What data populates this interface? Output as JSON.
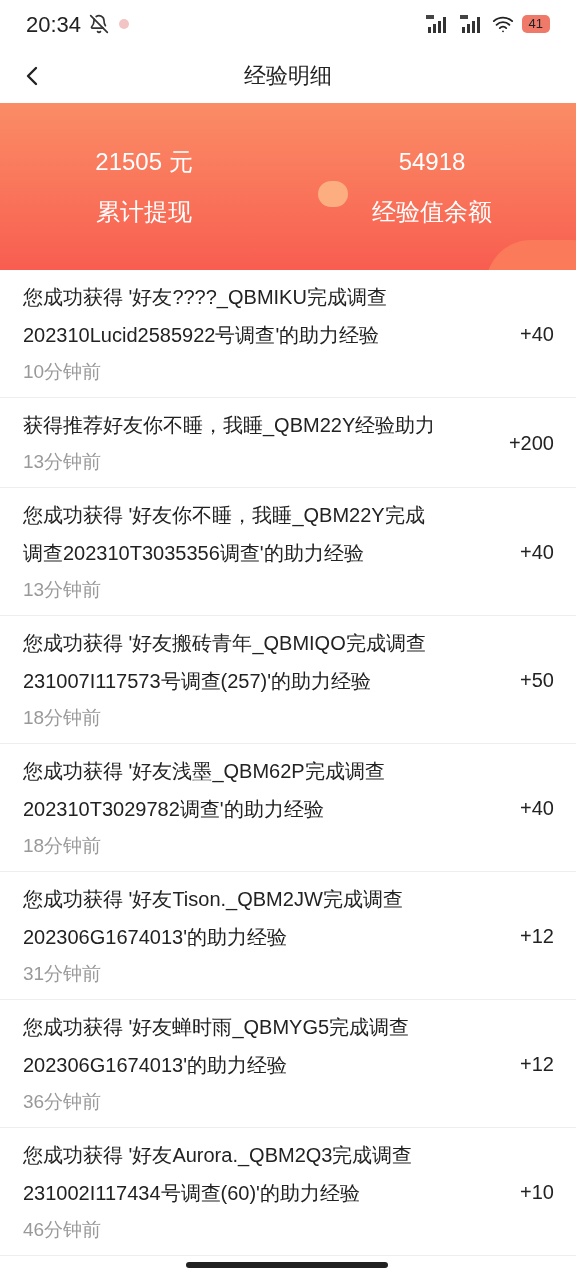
{
  "status_bar": {
    "time": "20:34",
    "battery": "41"
  },
  "header": {
    "title": "经验明细"
  },
  "summary": [
    {
      "value": "21505 元",
      "label": "累计提现"
    },
    {
      "value": "54918",
      "label": "经验值余额"
    }
  ],
  "records": [
    {
      "lines": [
        "您成功获得 '好友????_QBMIKU完成调查",
        "202310Lucid2585922号调查'的助力经验"
      ],
      "time": "10分钟前",
      "amount": "+40"
    },
    {
      "lines": [
        "获得推荐好友你不睡，我睡_QBM22Y经验助力"
      ],
      "time": "13分钟前",
      "amount": "+200"
    },
    {
      "lines": [
        "您成功获得 '好友你不睡，我睡_QBM22Y完成",
        "调查202310T3035356调查'的助力经验"
      ],
      "time": "13分钟前",
      "amount": "+40"
    },
    {
      "lines": [
        "您成功获得 '好友搬砖青年_QBMIQO完成调查",
        "231007I117573号调查(257)'的助力经验"
      ],
      "time": "18分钟前",
      "amount": "+50"
    },
    {
      "lines": [
        "您成功获得 '好友浅墨_QBM62P完成调查",
        "202310T3029782调查'的助力经验"
      ],
      "time": "18分钟前",
      "amount": "+40"
    },
    {
      "lines": [
        "您成功获得 '好友Tison._QBM2JW完成调查",
        "202306G1674013'的助力经验"
      ],
      "time": "31分钟前",
      "amount": "+12"
    },
    {
      "lines": [
        "您成功获得 '好友蝉时雨_QBMYG5完成调查",
        "202306G1674013'的助力经验"
      ],
      "time": "36分钟前",
      "amount": "+12"
    },
    {
      "lines": [
        "您成功获得 '好友Aurora._QBM2Q3完成调查",
        "231002I117434号调查(60)'的助力经验"
      ],
      "time": "46分钟前",
      "amount": "+10"
    }
  ]
}
